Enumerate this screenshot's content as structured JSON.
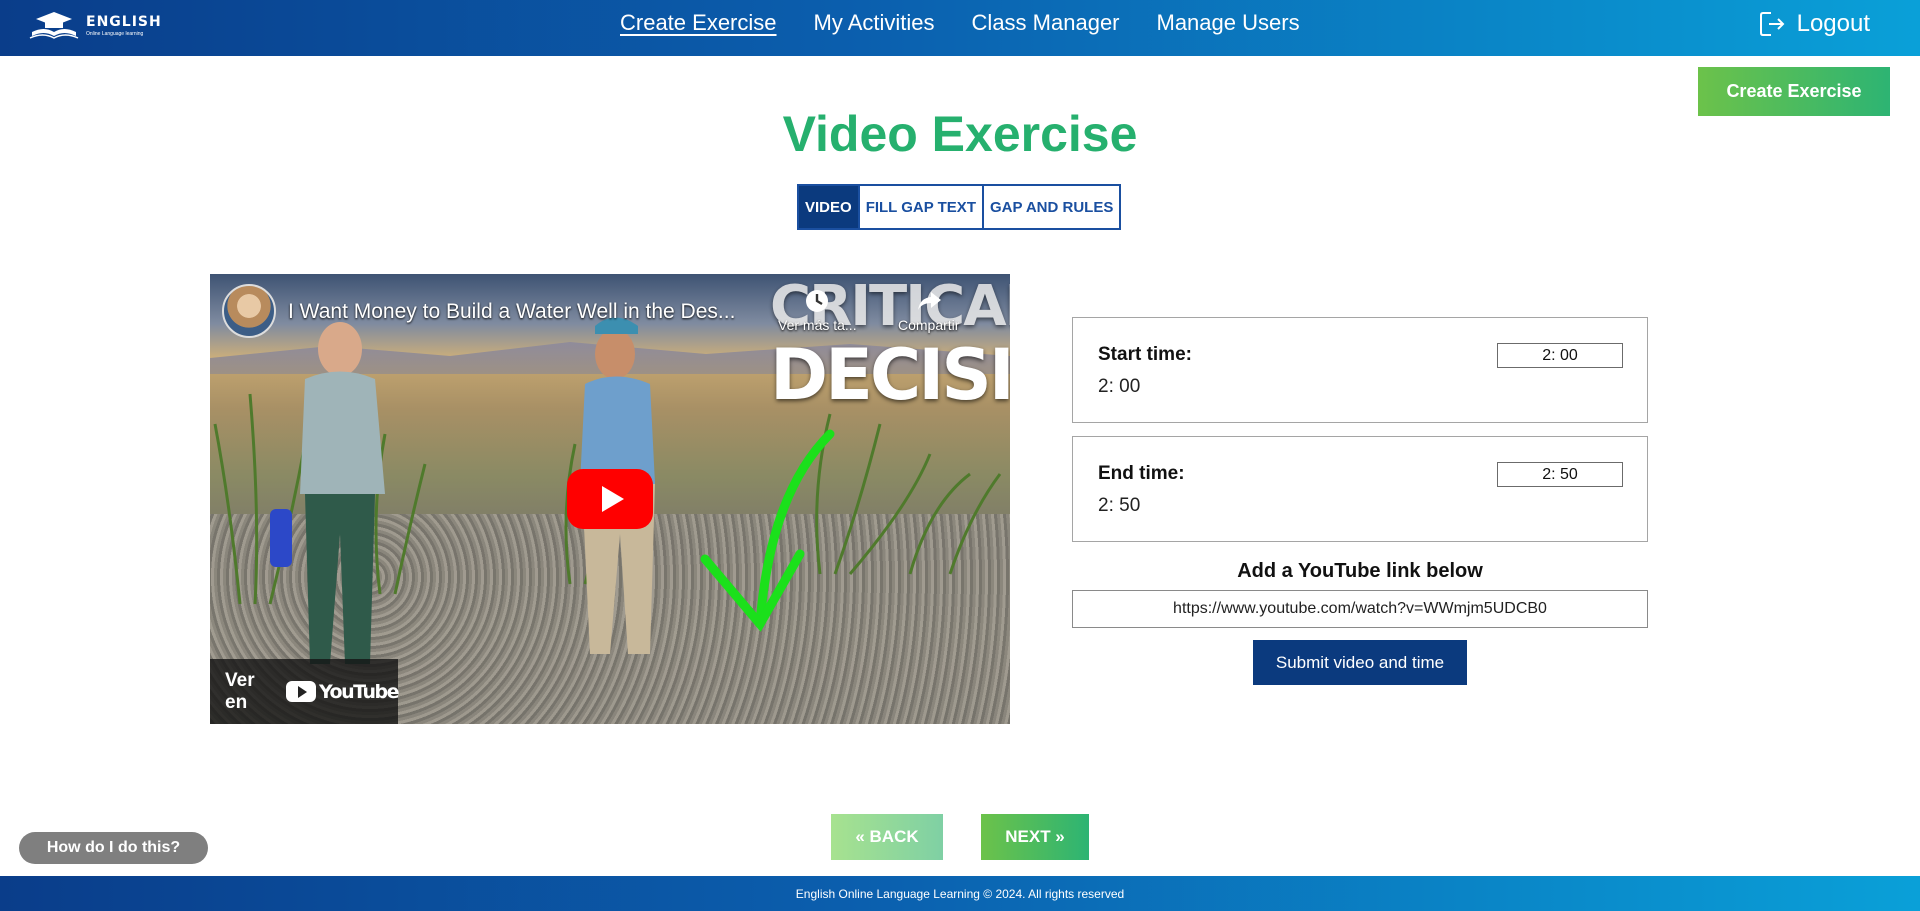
{
  "header": {
    "logo_title": "ENGLISH",
    "logo_subtitle": "Online Language learning",
    "nav": [
      {
        "label": "Create Exercise",
        "active": true
      },
      {
        "label": "My Activities",
        "active": false
      },
      {
        "label": "Class Manager",
        "active": false
      },
      {
        "label": "Manage Users",
        "active": false
      }
    ],
    "logout_label": "Logout"
  },
  "create_button_label": "Create Exercise",
  "page_title": "Video Exercise",
  "tabs": [
    {
      "label": "VIDEO",
      "active": true
    },
    {
      "label": "FILL GAP TEXT",
      "active": false
    },
    {
      "label": "GAP AND RULES",
      "active": false
    }
  ],
  "video": {
    "title": "I Want Money to Build a Water Well in the Des...",
    "overlay_line1": "CRITICAL",
    "overlay_line2": "DECISION",
    "watch_later": "Ver más ta...",
    "share": "Compartir",
    "watch_on": "Ver en",
    "youtube_word": "YouTube"
  },
  "start_time": {
    "label": "Start time:",
    "value_text": "2: 00",
    "input_value": "2: 00"
  },
  "end_time": {
    "label": "End time:",
    "value_text": "2: 50",
    "input_value": "2: 50"
  },
  "youtube_link": {
    "label": "Add a YouTube link below",
    "value": "https://www.youtube.com/watch?v=WWmjm5UDCB0"
  },
  "submit_label": "Submit video and time",
  "back_label": "« BACK",
  "next_label": "NEXT »",
  "help_label": "How do I do this?",
  "footer_text": "English Online Language Learning © 2024. All rights reserved",
  "colors": {
    "header_start": "#0a3d8a",
    "header_end": "#0aa0d8",
    "accent_green": "#26b06e",
    "primary_navy": "#0b3a7e"
  }
}
